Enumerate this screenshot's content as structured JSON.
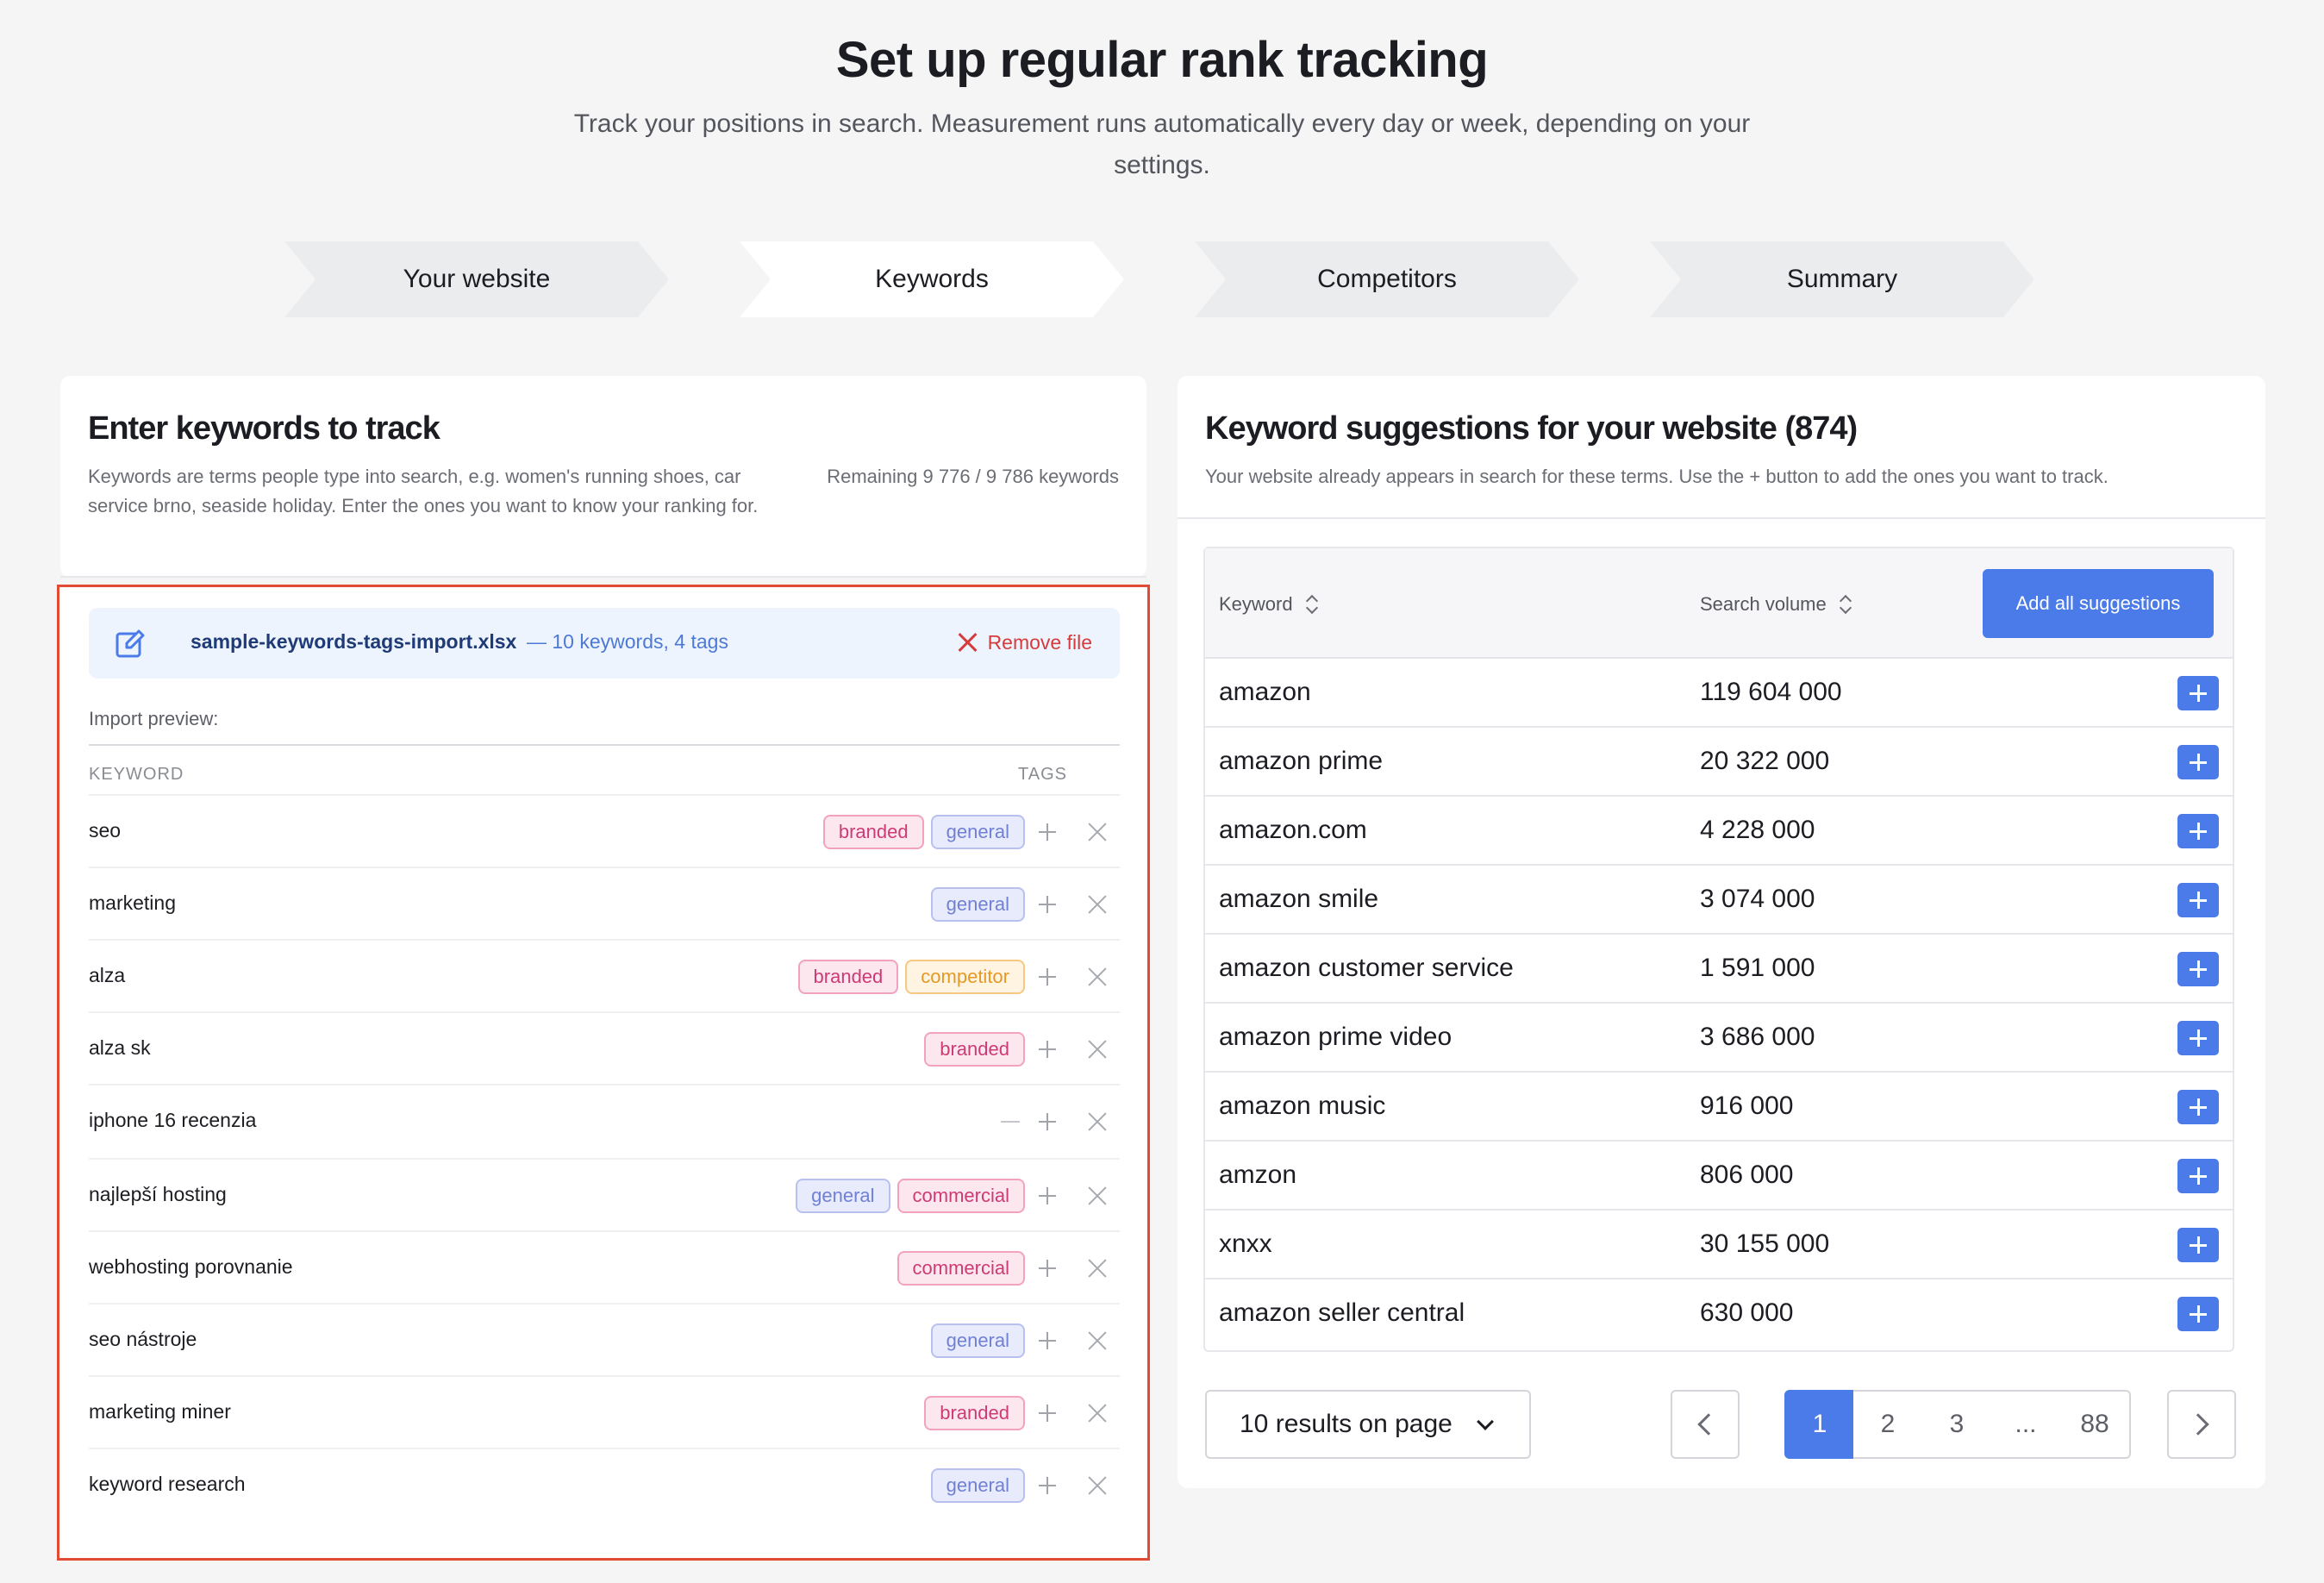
{
  "header": {
    "title": "Set up regular rank tracking",
    "subtitle": "Track your positions in search. Measurement runs automatically every day or week, depending on your settings."
  },
  "steps": [
    {
      "label": "Your website",
      "active": false
    },
    {
      "label": "Keywords",
      "active": true
    },
    {
      "label": "Competitors",
      "active": false
    },
    {
      "label": "Summary",
      "active": false
    }
  ],
  "left_panel": {
    "title": "Enter keywords to track",
    "description": "Keywords are terms people type into search, e.g. women's running shoes, car service brno, seaside holiday. Enter the ones you want to know your ranking for.",
    "remaining": "Remaining 9 776 / 9 786 keywords",
    "file": {
      "name": "sample-keywords-tags-import.xlsx",
      "meta": "— 10 keywords, 4 tags",
      "remove_label": "Remove file"
    },
    "preview_label": "Import preview:",
    "col_keyword": "KEYWORD",
    "col_tags": "TAGS",
    "rows": [
      {
        "keyword": "seo",
        "tags": [
          "branded",
          "general"
        ]
      },
      {
        "keyword": "marketing",
        "tags": [
          "general"
        ]
      },
      {
        "keyword": "alza",
        "tags": [
          "branded",
          "competitor"
        ]
      },
      {
        "keyword": "alza sk",
        "tags": [
          "branded"
        ]
      },
      {
        "keyword": "iphone 16 recenzia",
        "tags": []
      },
      {
        "keyword": "najlepší hosting",
        "tags": [
          "general",
          "commercial"
        ]
      },
      {
        "keyword": "webhosting porovnanie",
        "tags": [
          "commercial"
        ]
      },
      {
        "keyword": "seo nástroje",
        "tags": [
          "general"
        ]
      },
      {
        "keyword": "marketing miner",
        "tags": [
          "branded"
        ]
      },
      {
        "keyword": "keyword research",
        "tags": [
          "general"
        ]
      }
    ]
  },
  "right_panel": {
    "title": "Keyword suggestions for your website (874)",
    "description": "Your website already appears in search for these terms. Use the + button to add the ones you want to track.",
    "col_keyword": "Keyword",
    "col_volume": "Search volume",
    "add_all_label": "Add all suggestions",
    "rows": [
      {
        "keyword": "amazon",
        "volume": "119 604 000"
      },
      {
        "keyword": "amazon prime",
        "volume": "20 322 000"
      },
      {
        "keyword": "amazon.com",
        "volume": "4 228 000"
      },
      {
        "keyword": "amazon smile",
        "volume": "3 074 000"
      },
      {
        "keyword": "amazon customer service",
        "volume": "1 591 000"
      },
      {
        "keyword": "amazon prime video",
        "volume": "3 686 000"
      },
      {
        "keyword": "amazon music",
        "volume": "916 000"
      },
      {
        "keyword": "amzon",
        "volume": "806 000"
      },
      {
        "keyword": "xnxx",
        "volume": "30 155 000"
      },
      {
        "keyword": "amazon seller central",
        "volume": "630 000"
      }
    ],
    "per_page": "10 results on page",
    "pages": [
      "1",
      "2",
      "3",
      "...",
      "88"
    ],
    "current_page": "1"
  },
  "colors": {
    "accent": "#4b7be8",
    "highlight_border": "#e34a33",
    "remove": "#d63b3b"
  }
}
